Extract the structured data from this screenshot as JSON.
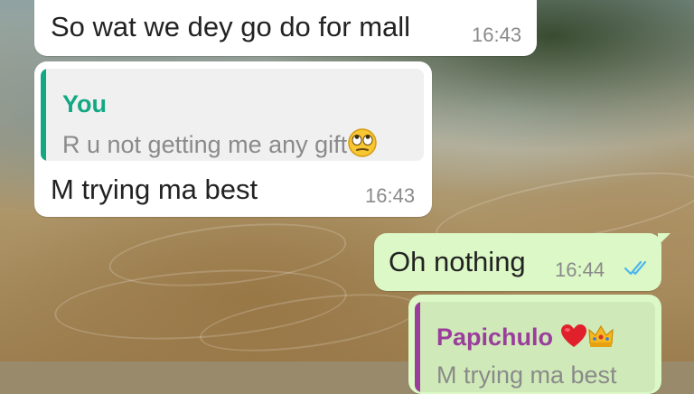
{
  "colors": {
    "incoming_bubble": "#ffffff",
    "outgoing_bubble": "#dcf8c6",
    "you_author": "#13a884",
    "papichulo_author": "#9a3d9c",
    "read_ticks": "#4fb6ec"
  },
  "messages": [
    {
      "text": "So wat we dey go do for mall",
      "time": "16:43",
      "direction": "incoming"
    },
    {
      "quote": {
        "author": "You",
        "text": "R u not getting me any gift",
        "emoji": "face-with-rolling-eyes"
      },
      "text": "M trying ma best",
      "time": "16:43",
      "direction": "incoming"
    },
    {
      "text": "Oh nothing",
      "time": "16:44",
      "direction": "outgoing",
      "status": "read",
      "status_icon": "double-check-icon"
    },
    {
      "quote": {
        "author": "Papichulo",
        "author_emojis": [
          "red-heart",
          "crown"
        ],
        "text": "M trying ma best"
      },
      "direction": "outgoing"
    }
  ]
}
